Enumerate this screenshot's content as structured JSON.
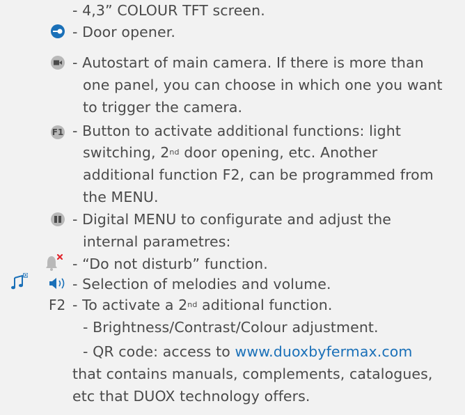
{
  "lines": {
    "screen": "- 4,3” COLOUR TFT screen.",
    "door_opener": "- Door opener.",
    "autostart_1": "- Autostart of main camera. If there is more than",
    "autostart_2": "one panel, you can choose in which one you want",
    "autostart_3": "to trigger the camera.",
    "f1_1": "- Button to activate additional functions: light",
    "f1_2a": "switching, 2",
    "f1_2sup": "nd",
    "f1_2b": " door opening, etc. Another",
    "f1_3": "additional function F2, can be programmed from",
    "f1_4": "the MENU.",
    "menu_1": "- Digital MENU to configurate and adjust the",
    "menu_2": "internal parametres:",
    "dnd": "- “Do not disturb” function.",
    "melodies": "- Selection of melodies and volume.",
    "f2_a": "- To activate a 2",
    "f2_sup": "nd",
    "f2_b": " aditional function.",
    "brightness": "-  Brightness/Contrast/Colour adjustment.",
    "qr_a": "- QR code: access to ",
    "qr_link": "www.duoxbyfermax.com",
    "qr_2": "that contains manuals, complements, catalogues,",
    "qr_3": "etc that DUOX technology offers."
  },
  "icons": {
    "f1_label": "F1",
    "f2_label": "F2"
  },
  "colors": {
    "text": "#4a4a4a",
    "accent": "#1a70b8",
    "icon_gray": "#b8b8b8",
    "dnd_mark": "#e0262e"
  }
}
